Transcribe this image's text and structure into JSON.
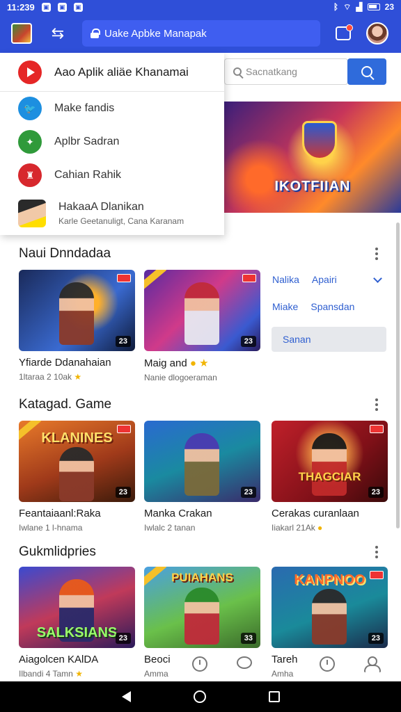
{
  "status_bar": {
    "time": "11:239",
    "right_time": "23"
  },
  "app_bar": {
    "url_text": "Uake Apbke Manapak"
  },
  "dropdown": {
    "first": "Aao Aplik aliäe Khanamai",
    "items": [
      {
        "label": "Make fandis",
        "icon": "twitter-icon"
      },
      {
        "label": "Aplbr Sadran",
        "icon": "green-app-icon"
      },
      {
        "label": "Cahian Rahik",
        "icon": "red-app-icon"
      },
      {
        "label": "HakaaA Dlanikan",
        "sub": "Karle Geetanuligt, Cana Karanam",
        "icon": "avatar"
      }
    ]
  },
  "search": {
    "placeholder": "Sacnatkang"
  },
  "hero": {
    "title": "IKOTFIIAN"
  },
  "sections": [
    {
      "title": "Naui Dnndadaa",
      "cards": [
        {
          "title": "Yfiarde Ddanahaian",
          "sub": "1ltaraa 2 10ak",
          "num": "23"
        },
        {
          "title": "Maig and",
          "sub": "Nanie dlogoeraman",
          "num": "23"
        }
      ],
      "side_options": [
        {
          "a": "Nalika",
          "b": "Apairi"
        },
        {
          "a": "Miake",
          "b": "Spansdan"
        }
      ],
      "side_button": "Sanan"
    },
    {
      "title": "Katagad. Game",
      "cards": [
        {
          "title": "Feantaiaanl:Raka",
          "sub": "Iwlane 1 l-hnama",
          "num": "23",
          "art": "KLANINES"
        },
        {
          "title": "Manka Crakan",
          "sub": "Iwlalc 2 tanan",
          "num": "23"
        },
        {
          "title": "Cerakas curanlaan",
          "sub": "Iiakarl 21Ak",
          "num": "23",
          "art": "THAGCIAR"
        }
      ]
    },
    {
      "title": "Gukmlidpries",
      "cards": [
        {
          "title": "Aiagolcen KAlDA",
          "sub": "Ilbandi 4 Tamn",
          "num": "23",
          "art": "SALKSIANS"
        },
        {
          "title": "Beoci",
          "sub": "Amma",
          "num": "33",
          "art": "PUIAHANS"
        },
        {
          "title": "Tareh",
          "sub": "Amha",
          "num": "23",
          "art": "KANPNOO"
        }
      ]
    }
  ]
}
